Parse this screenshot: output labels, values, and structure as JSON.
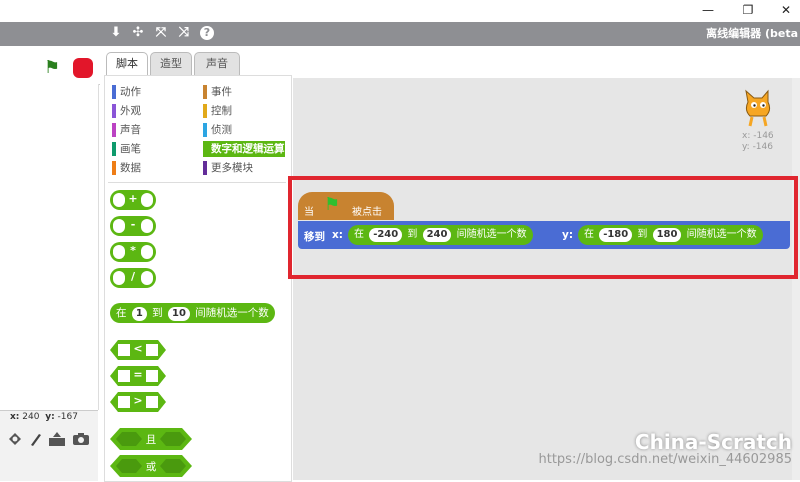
{
  "window": {
    "minimize": "—",
    "restore": "❐",
    "close": "✕"
  },
  "menubar": {
    "icons": [
      "stamp-icon",
      "cut-icon",
      "grow-icon",
      "shrink-icon",
      "help-icon"
    ],
    "glyphs": [
      "⬇",
      "✣",
      "⤧",
      "⤨",
      "?"
    ],
    "app_title": "离线编辑器 (beta"
  },
  "stage": {
    "flag": "⚑",
    "stop": "●",
    "mouse_x_label": "x:",
    "mouse_x": "240",
    "mouse_y_label": "y:",
    "mouse_y": "-167"
  },
  "tabs": [
    "脚本",
    "造型",
    "声音"
  ],
  "categories": [
    {
      "label": "动作",
      "color": "#4a6cd4"
    },
    {
      "label": "事件",
      "color": "#c88330"
    },
    {
      "label": "外观",
      "color": "#8a55d7"
    },
    {
      "label": "控制",
      "color": "#e1a91a"
    },
    {
      "label": "声音",
      "color": "#bb42c3"
    },
    {
      "label": "侦测",
      "color": "#2ca5e2"
    },
    {
      "label": "画笔",
      "color": "#0e9a6c"
    },
    {
      "label": "数字和逻辑运算",
      "color": "#5cb712"
    },
    {
      "label": "数据",
      "color": "#ee7d16"
    },
    {
      "label": "更多模块",
      "color": "#632d99"
    }
  ],
  "palette": {
    "ops": [
      "+",
      "-",
      "*",
      "/"
    ],
    "random": {
      "prefix": "在",
      "from": "1",
      "mid": "到",
      "to": "10",
      "suffix": "间随机选一个数"
    },
    "compare": [
      "<",
      "=",
      ">"
    ],
    "logic": [
      "且",
      "或"
    ]
  },
  "sprite": {
    "x": "x: -146",
    "y": "y: -146"
  },
  "script": {
    "hat_prefix": "当",
    "hat_suffix": "被点击",
    "move_label": "移到",
    "x_label": "x:",
    "y_label": "y:",
    "rx": {
      "prefix": "在",
      "from": "-240",
      "mid": "到",
      "to": "240",
      "suffix": "间随机选一个数"
    },
    "ry": {
      "prefix": "在",
      "from": "-180",
      "mid": "到",
      "to": "180",
      "suffix": "间随机选一个数"
    }
  },
  "watermark": {
    "brand": "China-Scratch",
    "url": "https://blog.csdn.net/weixin_44602985"
  },
  "colors": {
    "motion": "#4a6cd4",
    "events": "#c88330",
    "operators": "#5cb712",
    "highlight": "#e0262f"
  }
}
